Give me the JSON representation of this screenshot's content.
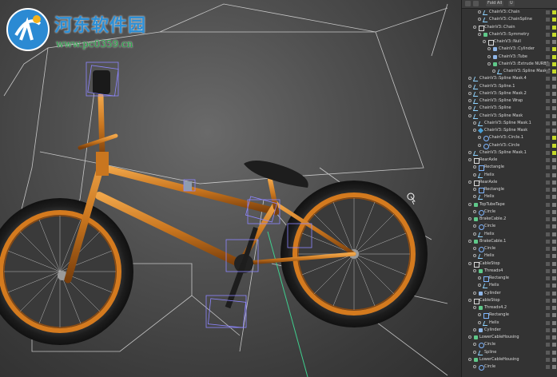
{
  "watermark": {
    "title": "河东软件园",
    "url": "www.pc0359.cn"
  },
  "viewport": {
    "background": "#4a4a4a",
    "bike_frame_color": "#c9761f"
  },
  "panel": {
    "fold_all_label": "Fold All",
    "extra_label": "U",
    "rows": [
      {
        "label": "ChainV3::Chain",
        "indent": 3,
        "icon": "spline",
        "vis": "on"
      },
      {
        "label": "ChainV3::ChainSpline",
        "indent": 3,
        "icon": "spline",
        "vis": "on"
      },
      {
        "label": "ChainV3::Chain",
        "indent": 2,
        "icon": "null",
        "vis": "on"
      },
      {
        "label": "ChainV3::Symmetry",
        "indent": 3,
        "icon": "gen",
        "vis": "on"
      },
      {
        "label": "ChainV3::Null",
        "indent": 4,
        "icon": "null",
        "vis": "off"
      },
      {
        "label": "ChainV3::Cylinder",
        "indent": 5,
        "icon": "obj",
        "vis": "on"
      },
      {
        "label": "ChainV3::Tube",
        "indent": 5,
        "icon": "obj",
        "vis": "on"
      },
      {
        "label": "ChainV3::Extrude NURBS",
        "indent": 5,
        "icon": "gen",
        "vis": "on"
      },
      {
        "label": "ChainV3::Spline Mask.2",
        "indent": 6,
        "icon": "spline",
        "vis": "on"
      },
      {
        "label": "ChainV3::Spline Mask.4",
        "indent": 1,
        "icon": "spline",
        "vis": "off"
      },
      {
        "label": "ChainV3::Spline.1",
        "indent": 1,
        "icon": "spline",
        "vis": "off"
      },
      {
        "label": "ChainV3::Spline Mask.2",
        "indent": 1,
        "icon": "spline",
        "vis": "off"
      },
      {
        "label": "ChainV3::Spline Wrap",
        "indent": 1,
        "icon": "spline",
        "vis": "off"
      },
      {
        "label": "ChainV3::Spline",
        "indent": 1,
        "icon": "spline",
        "vis": "off"
      },
      {
        "label": "ChainV3::Spline Mask",
        "indent": 1,
        "icon": "spline",
        "vis": "off"
      },
      {
        "label": "ChainV3::Spline Mask.1",
        "indent": 2,
        "icon": "spline",
        "vis": "off"
      },
      {
        "label": "ChainV3::Spline Mask",
        "indent": 2,
        "icon": "mask",
        "vis": "off"
      },
      {
        "label": "ChainV3::Circle.1",
        "indent": 3,
        "icon": "shape",
        "vis": "on"
      },
      {
        "label": "ChainV3::Circle",
        "indent": 3,
        "icon": "shape",
        "vis": "on"
      },
      {
        "label": "ChainV3::Spline Mask.1",
        "indent": 1,
        "icon": "spline",
        "vis": "on"
      },
      {
        "label": "RearAxle",
        "indent": 1,
        "icon": "null",
        "vis": "off"
      },
      {
        "label": "Rectangle",
        "indent": 2,
        "icon": "rect",
        "vis": "off"
      },
      {
        "label": "Helix",
        "indent": 2,
        "icon": "spline",
        "vis": "off"
      },
      {
        "label": "RearAxle",
        "indent": 1,
        "icon": "null",
        "vis": "off"
      },
      {
        "label": "Rectangle",
        "indent": 2,
        "icon": "rect",
        "vis": "off"
      },
      {
        "label": "Helix",
        "indent": 2,
        "icon": "spline",
        "vis": "off"
      },
      {
        "label": "TopTubeTape",
        "indent": 1,
        "icon": "gen",
        "vis": "off"
      },
      {
        "label": "Circle",
        "indent": 2,
        "icon": "shape",
        "vis": "off"
      },
      {
        "label": "BrakeCable.2",
        "indent": 1,
        "icon": "gen",
        "vis": "off"
      },
      {
        "label": "Circle",
        "indent": 2,
        "icon": "shape",
        "vis": "off"
      },
      {
        "label": "Helix",
        "indent": 2,
        "icon": "spline",
        "vis": "off"
      },
      {
        "label": "BrakeCable.1",
        "indent": 1,
        "icon": "gen",
        "vis": "off"
      },
      {
        "label": "Circle",
        "indent": 2,
        "icon": "shape",
        "vis": "off"
      },
      {
        "label": "Helix",
        "indent": 2,
        "icon": "spline",
        "vis": "off"
      },
      {
        "label": "CableStop",
        "indent": 1,
        "icon": "null",
        "vis": "off"
      },
      {
        "label": "Threads4",
        "indent": 2,
        "icon": "gen",
        "vis": "off"
      },
      {
        "label": "Rectangle",
        "indent": 3,
        "icon": "rect",
        "vis": "off"
      },
      {
        "label": "Helix",
        "indent": 3,
        "icon": "spline",
        "vis": "off"
      },
      {
        "label": "Cylinder",
        "indent": 2,
        "icon": "obj",
        "vis": "off"
      },
      {
        "label": "CableStop",
        "indent": 1,
        "icon": "null",
        "vis": "off"
      },
      {
        "label": "Threads4.2",
        "indent": 2,
        "icon": "gen",
        "vis": "off"
      },
      {
        "label": "Rectangle",
        "indent": 3,
        "icon": "rect",
        "vis": "off"
      },
      {
        "label": "Helix",
        "indent": 3,
        "icon": "spline",
        "vis": "off"
      },
      {
        "label": "Cylinder",
        "indent": 2,
        "icon": "obj",
        "vis": "off"
      },
      {
        "label": "LowerCableHousing",
        "indent": 1,
        "icon": "gen",
        "vis": "off"
      },
      {
        "label": "Circle",
        "indent": 2,
        "icon": "shape",
        "vis": "off"
      },
      {
        "label": "Spline",
        "indent": 2,
        "icon": "spline",
        "vis": "off"
      },
      {
        "label": "LowerCableHousing",
        "indent": 1,
        "icon": "gen",
        "vis": "off"
      },
      {
        "label": "Circle",
        "indent": 2,
        "icon": "shape",
        "vis": "off"
      }
    ]
  }
}
